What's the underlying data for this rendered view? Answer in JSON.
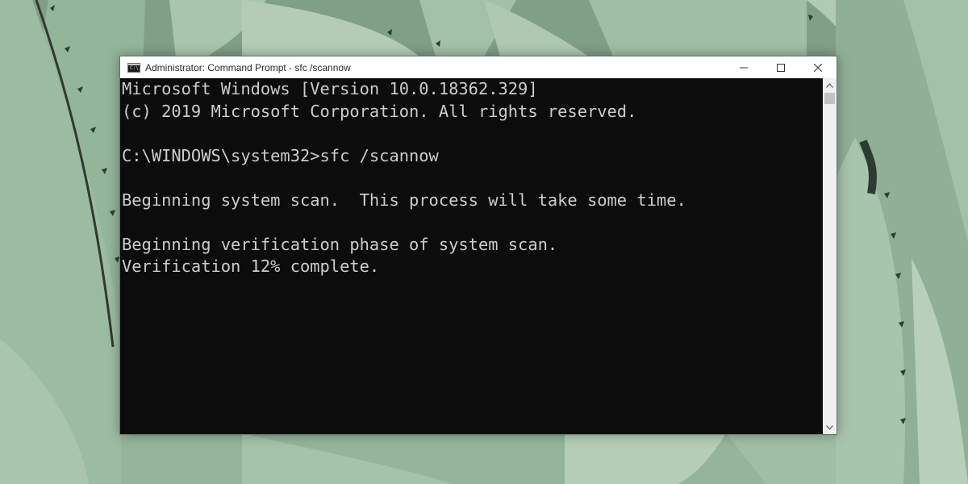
{
  "window": {
    "title": "Administrator: Command Prompt - sfc  /scannow",
    "icon_text": "C:\\.",
    "controls": {
      "minimize": "minimize-icon",
      "maximize": "maximize-icon",
      "close": "close-icon"
    }
  },
  "console": {
    "lines": [
      "Microsoft Windows [Version 10.0.18362.329]",
      "(c) 2019 Microsoft Corporation. All rights reserved.",
      "",
      "C:\\WINDOWS\\system32>sfc /scannow",
      "",
      "Beginning system scan.  This process will take some time.",
      "",
      "Beginning verification phase of system scan.",
      "Verification 12% complete."
    ],
    "text_color": "#cccccc",
    "background_color": "#0c0c0c"
  },
  "scrollbar": {
    "up_icon": "chevron-up-icon",
    "down_icon": "chevron-down-icon"
  },
  "desktop": {
    "wallpaper": "agave-plant-wallpaper"
  }
}
